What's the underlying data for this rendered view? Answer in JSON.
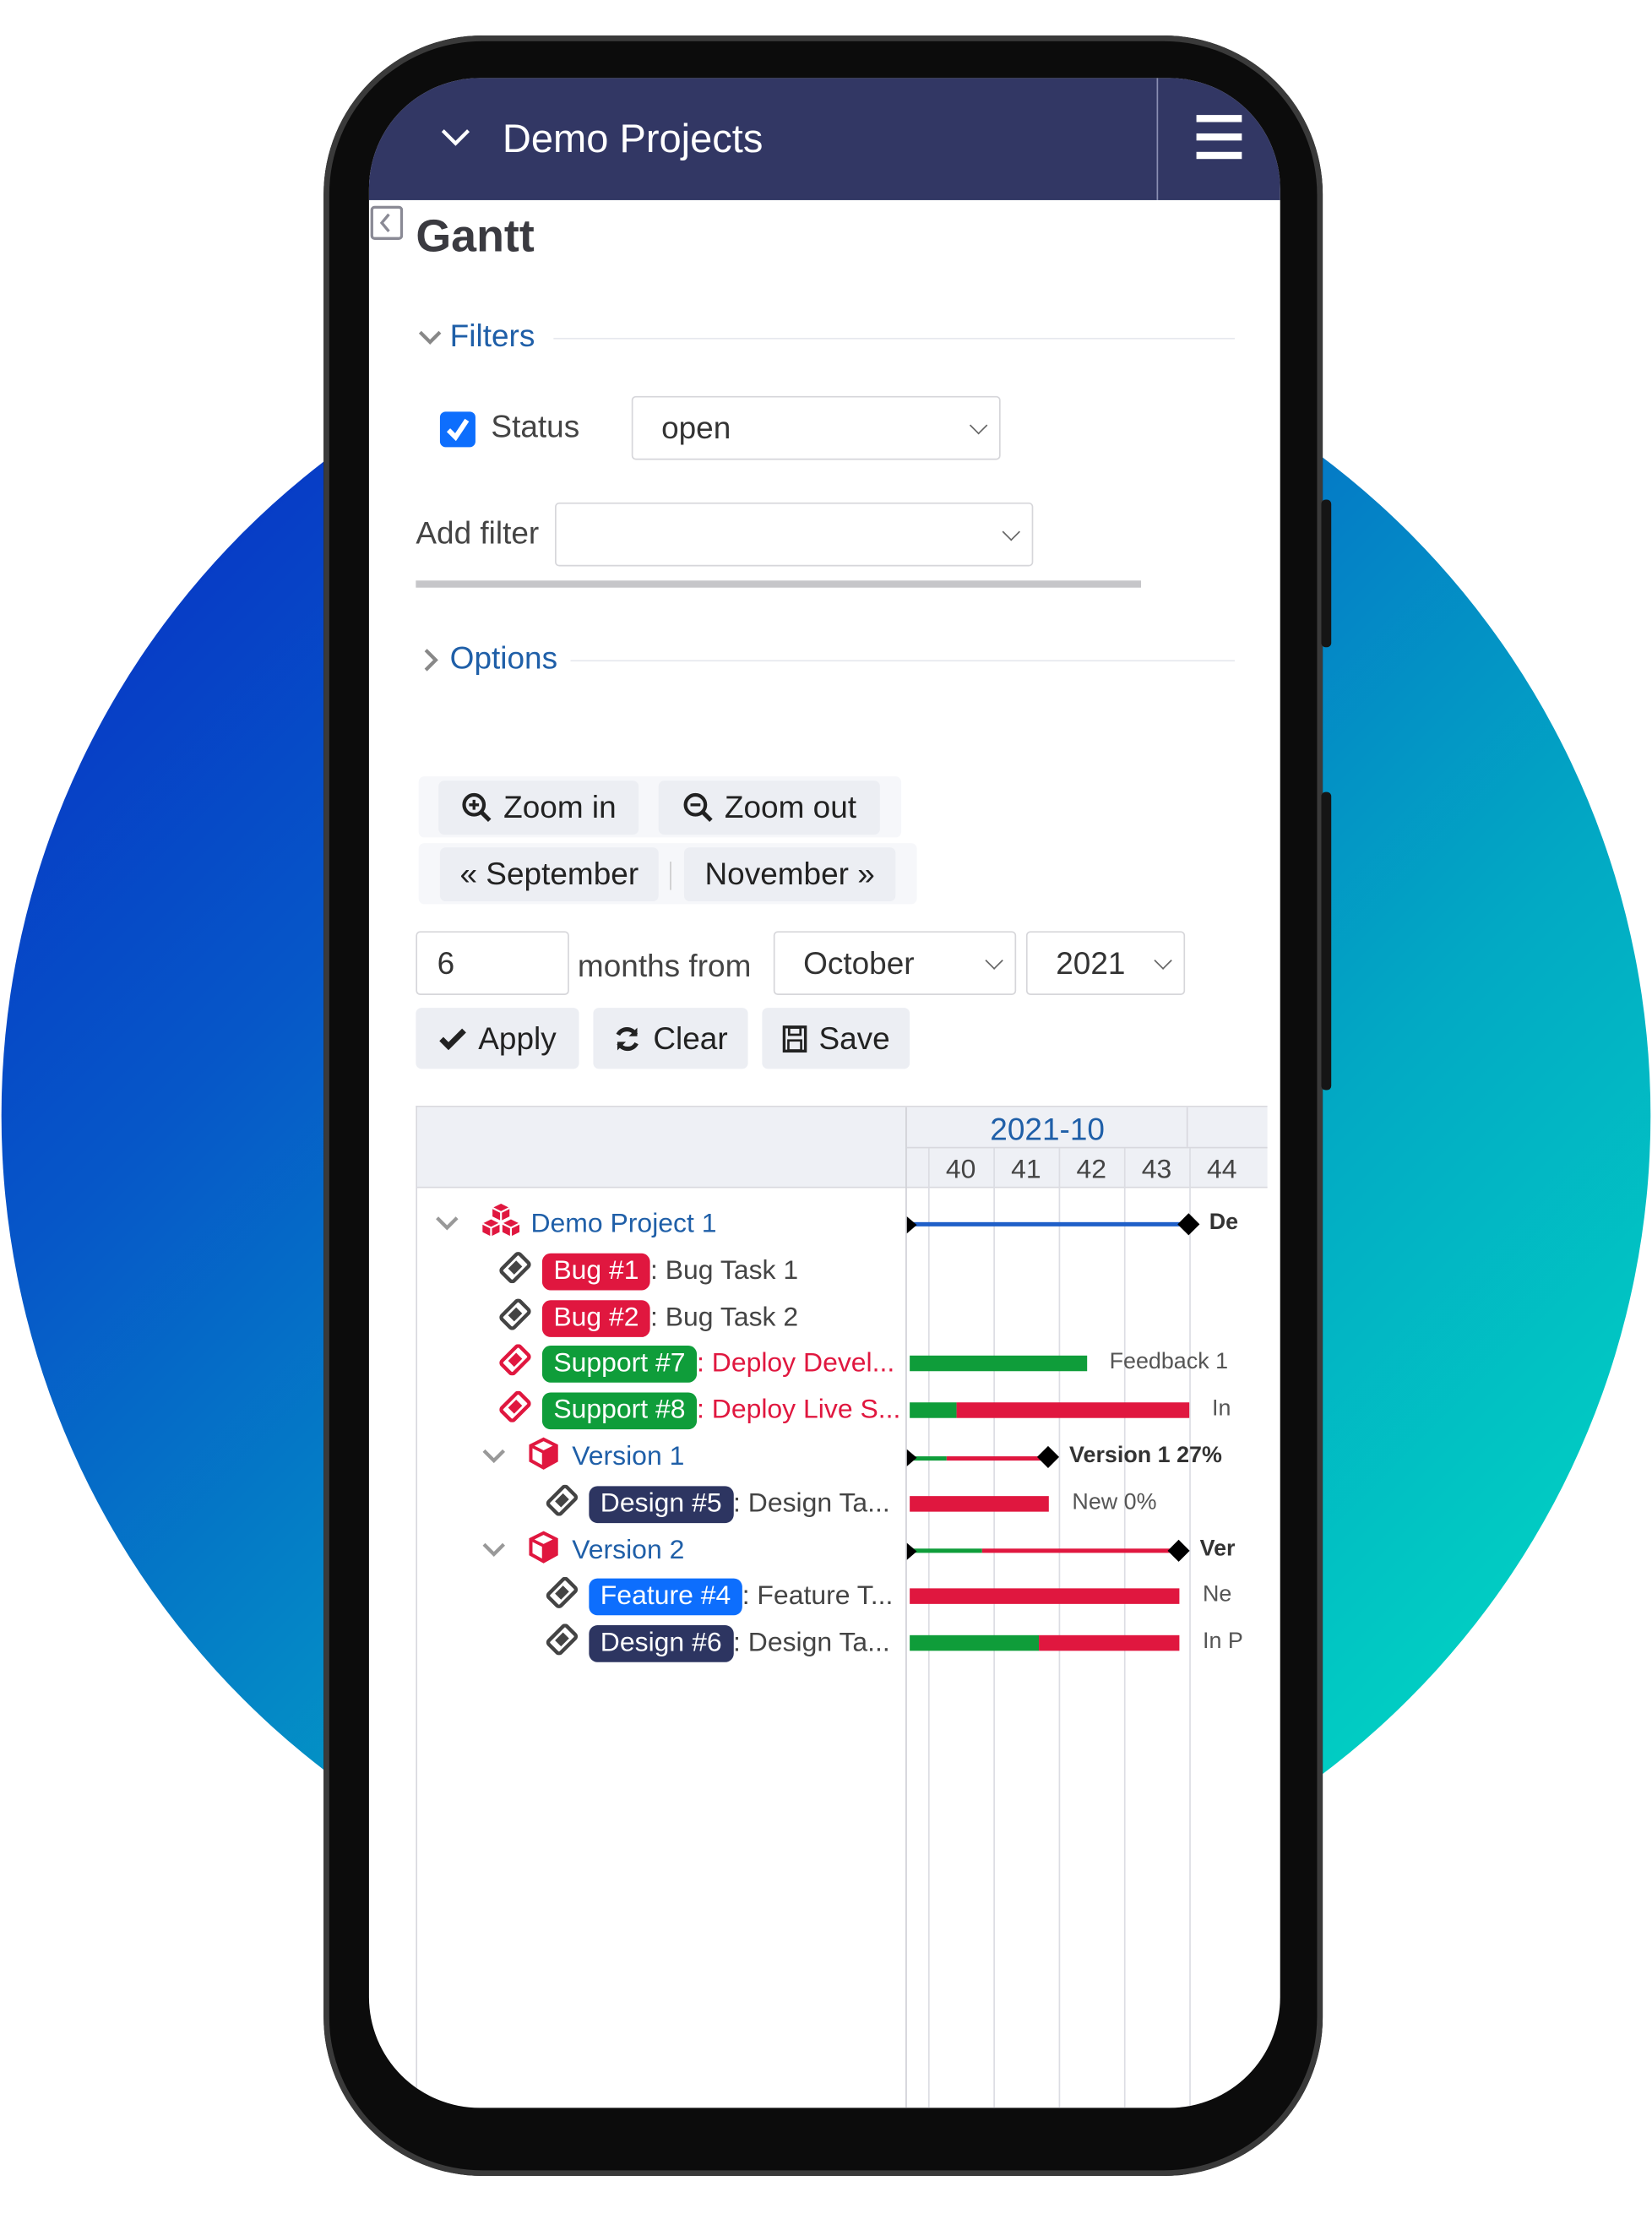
{
  "header": {
    "title": "Demo Projects",
    "menu_icon": "hamburger-icon",
    "dropdown_icon": "chevron-down-icon"
  },
  "page": {
    "title": "Gantt"
  },
  "filters": {
    "label": "Filters",
    "status_label": "Status",
    "status_checked": true,
    "status_value": "open",
    "add_filter_label": "Add filter",
    "add_filter_value": ""
  },
  "options": {
    "label": "Options"
  },
  "toolbar": {
    "zoom_in": "Zoom in",
    "zoom_out": "Zoom out",
    "prev": "« September",
    "next": "November »",
    "months_value": "6",
    "months_from": "months from",
    "month_value": "October",
    "year_value": "2021",
    "apply": "Apply",
    "clear": "Clear",
    "save": "Save"
  },
  "colors": {
    "header": "#323764",
    "bug": "#e0173f",
    "support": "#0f9d3a",
    "design": "#2d3561",
    "feature": "#0d6efd",
    "done": "#0f9d3a",
    "todo": "#e0173f",
    "project_line": "#1f5fc8",
    "link": "#1f5fa8"
  },
  "gantt": {
    "month": "2021-10",
    "weeks": [
      "40",
      "41",
      "42",
      "43",
      "44"
    ],
    "rows": [
      {
        "type": "project",
        "name": "Demo Project 1",
        "start": "2021-10-02",
        "end": "2021-11-01",
        "label": "De"
      },
      {
        "type": "issue",
        "level": 1,
        "tracker": "Bug #1",
        "tracker_kind": "bug",
        "subject": ": Bug Task 1"
      },
      {
        "type": "issue",
        "level": 1,
        "tracker": "Bug #2",
        "tracker_kind": "bug",
        "subject": ": Bug Task 2"
      },
      {
        "type": "issue",
        "level": 1,
        "tracker": "Support #7",
        "tracker_kind": "support",
        "subject": ": Deploy Devel...",
        "subject_red": true,
        "start": "2021-10-02",
        "end": "2021-10-21",
        "done": 100,
        "label": "Feedback 1"
      },
      {
        "type": "issue",
        "level": 1,
        "tracker": "Support #8",
        "tracker_kind": "support",
        "subject": ": Deploy Live S...",
        "subject_red": true,
        "start": "2021-10-02",
        "end": "2021-11-01",
        "done": 17,
        "label": "In"
      },
      {
        "type": "version",
        "name": "Version 1",
        "start": "2021-10-02",
        "end": "2021-10-17",
        "done": 27,
        "label": "Version 1 27%"
      },
      {
        "type": "issue",
        "level": 2,
        "tracker": "Design #5",
        "tracker_kind": "design",
        "subject": ": Design Ta...",
        "start": "2021-10-02",
        "end": "2021-10-17",
        "done": 0,
        "label": "New 0%"
      },
      {
        "type": "version",
        "name": "Version 2",
        "start": "2021-10-02",
        "end": "2021-10-31",
        "done": 27,
        "label": "Ver"
      },
      {
        "type": "issue",
        "level": 2,
        "tracker": "Feature #4",
        "tracker_kind": "feature",
        "subject": ": Feature T...",
        "start": "2021-10-02",
        "end": "2021-10-31",
        "done": 0,
        "label": "Ne"
      },
      {
        "type": "issue",
        "level": 2,
        "tracker": "Design #6",
        "tracker_kind": "design",
        "subject": ": Design Ta...",
        "start": "2021-10-02",
        "end": "2021-10-31",
        "done": 48,
        "label": "In P"
      }
    ]
  }
}
